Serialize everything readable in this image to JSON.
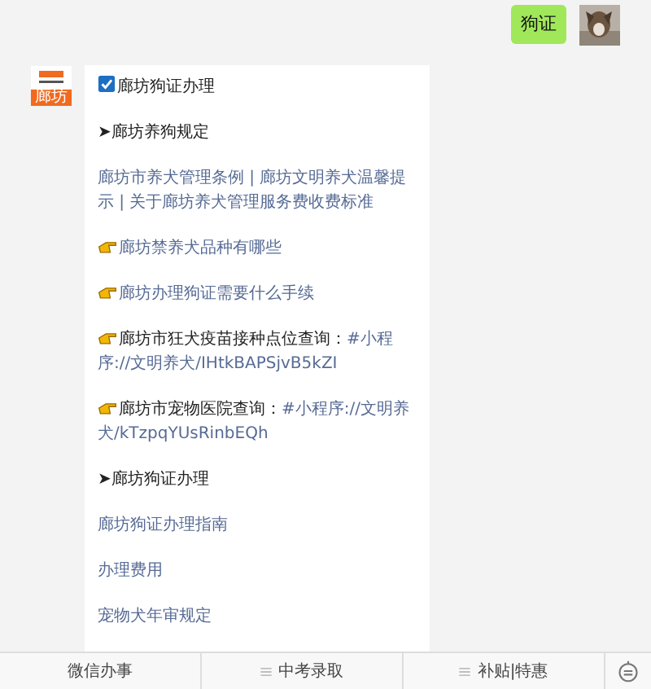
{
  "user_message": {
    "text": "狗证"
  },
  "bot": {
    "logo_text": "廊坊",
    "paragraphs": [
      {
        "kind": "check",
        "parts": [
          {
            "text": "廊坊狗证办理",
            "link": false
          }
        ]
      },
      {
        "kind": "plain",
        "parts": [
          {
            "text": "➤廊坊养狗规定",
            "link": false
          }
        ]
      },
      {
        "kind": "plain",
        "parts": [
          {
            "text": "廊坊市养犬管理条例 | 廊坊文明养犬温馨提示 | 关于廊坊养犬管理服务费收费标准",
            "link": true
          }
        ]
      },
      {
        "kind": "hand",
        "parts": [
          {
            "text": "廊坊禁养犬品种有哪些",
            "link": true
          }
        ]
      },
      {
        "kind": "hand",
        "parts": [
          {
            "text": "廊坊办理狗证需要什么手续",
            "link": true
          }
        ]
      },
      {
        "kind": "hand",
        "parts": [
          {
            "text": "廊坊市狂犬疫苗接种点位查询：",
            "link": false
          },
          {
            "text": "#小程",
            "link": true
          },
          {
            "text": "序://文明养犬/IHtkBAPSjvB5kZI",
            "link": true
          }
        ]
      },
      {
        "kind": "hand",
        "parts": [
          {
            "text": "廊坊市宠物医院查询：",
            "link": false
          },
          {
            "text": "#小程序://文明养",
            "link": true
          },
          {
            "text": "犬/kTzpqYUsRinbEQh",
            "link": true
          }
        ]
      },
      {
        "kind": "plain",
        "parts": [
          {
            "text": "➤廊坊狗证办理",
            "link": false
          }
        ]
      },
      {
        "kind": "plain",
        "parts": [
          {
            "text": "廊坊狗证办理指南",
            "link": true
          }
        ]
      },
      {
        "kind": "plain",
        "parts": [
          {
            "text": "办理费用",
            "link": true
          }
        ]
      },
      {
        "kind": "plain",
        "parts": [
          {
            "text": "宠物犬年审规定",
            "link": true
          }
        ]
      }
    ]
  },
  "menu": [
    {
      "label": "微信办事",
      "has_submenu": false
    },
    {
      "label": "中考录取",
      "has_submenu": true
    },
    {
      "label": "补贴|特惠",
      "has_submenu": true
    }
  ]
}
